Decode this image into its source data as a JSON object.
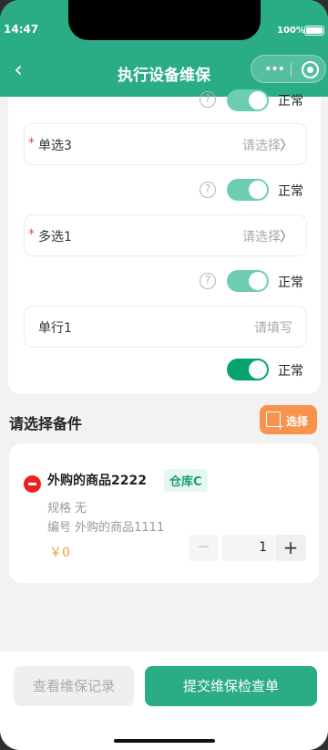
{
  "status_bar": {
    "time": "14:47",
    "battery": "100%"
  },
  "nav": {
    "title": "执行设备维保",
    "capsule_icons": [
      "more-icon",
      "target-icon"
    ]
  },
  "rows": {
    "row0": {
      "status": "正常"
    },
    "single3": {
      "required": "*",
      "label": "单选3",
      "placeholder": "请选择",
      "chevron": "〉",
      "status": "正常"
    },
    "multi1": {
      "required": "*",
      "label": "多选1",
      "placeholder": "请选择",
      "chevron": "〉",
      "status": "正常"
    },
    "line1": {
      "label": "单行1",
      "placeholder": "请填写",
      "status": "正常"
    },
    "help_glyph": "?"
  },
  "parts_section": {
    "title": "请选择备件",
    "select_label": "选择"
  },
  "part": {
    "name": "外购的商品2222",
    "warehouse": "仓库C",
    "spec": "规格 无",
    "code": "编号 外购的商品1111",
    "price": "￥0",
    "quantity": "1",
    "minus": "−",
    "plus": "+"
  },
  "footer": {
    "records_label": "查看维保记录",
    "submit_label": "提交维保检查单"
  },
  "colors": {
    "primary": "#2aac86",
    "accent": "#f7934c",
    "danger": "#f02020",
    "price": "#f0a13c"
  }
}
